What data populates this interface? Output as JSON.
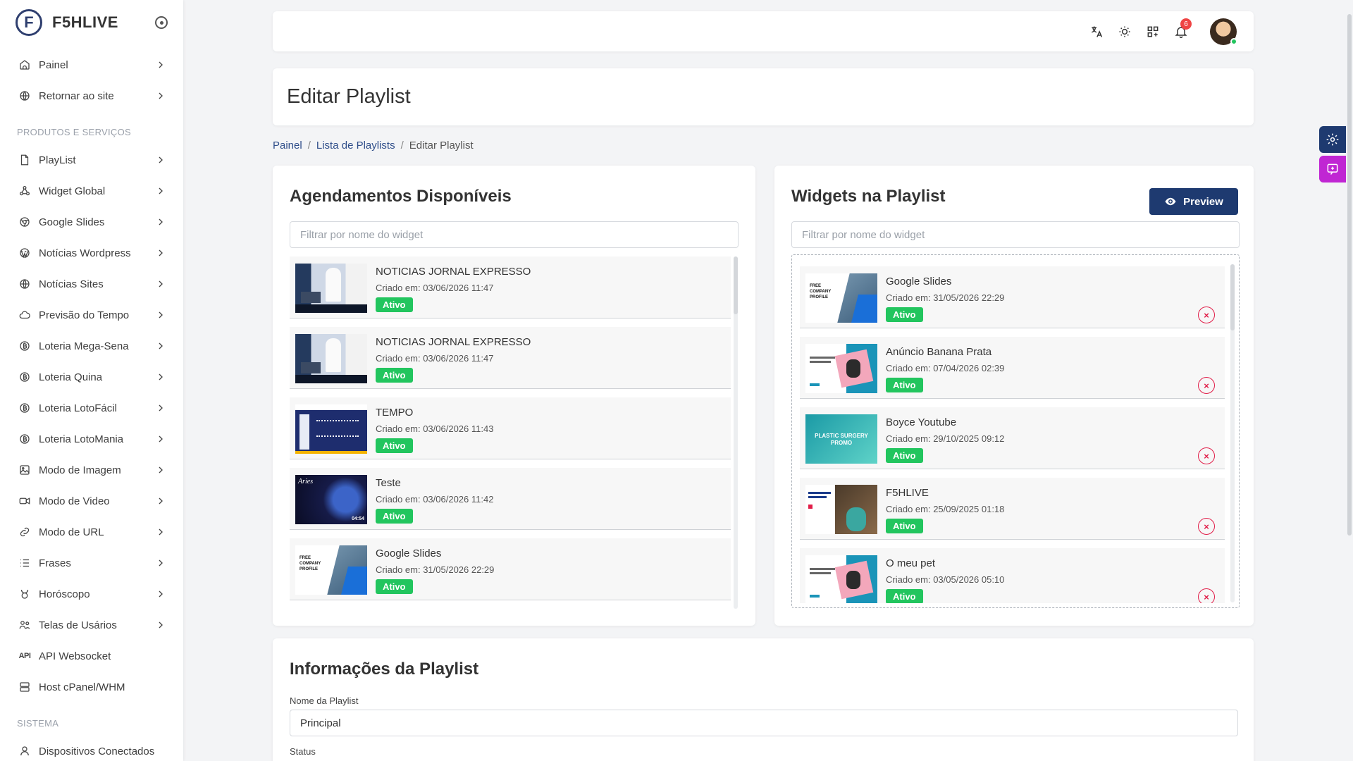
{
  "brand": {
    "name": "F5HLIVE",
    "logo_letter": "F"
  },
  "sidebar": {
    "top_items": [
      {
        "label": "Painel",
        "icon": "home-icon"
      },
      {
        "label": "Retornar ao site",
        "icon": "globe-icon"
      }
    ],
    "section_products": "PRODUTOS E SERVIÇOS",
    "product_items": [
      {
        "label": "PlayList",
        "icon": "file-icon"
      },
      {
        "label": "Widget Global",
        "icon": "share-icon"
      },
      {
        "label": "Google Slides",
        "icon": "chrome-icon"
      },
      {
        "label": "Notícias Wordpress",
        "icon": "wordpress-icon"
      },
      {
        "label": "Notícias Sites",
        "icon": "globe-icon"
      },
      {
        "label": "Previsão do Tempo",
        "icon": "cloud-icon"
      },
      {
        "label": "Loteria Mega-Sena",
        "icon": "coin-icon"
      },
      {
        "label": "Loteria Quina",
        "icon": "coin-icon"
      },
      {
        "label": "Loteria LotoFácil",
        "icon": "coin-icon"
      },
      {
        "label": "Loteria LotoMania",
        "icon": "coin-icon"
      },
      {
        "label": "Modo de Imagem",
        "icon": "image-icon"
      },
      {
        "label": "Modo de Video",
        "icon": "video-icon"
      },
      {
        "label": "Modo de URL",
        "icon": "link-icon"
      },
      {
        "label": "Frases",
        "icon": "list-icon"
      },
      {
        "label": "Horóscopo",
        "icon": "taurus-icon"
      },
      {
        "label": "Telas de Usários",
        "icon": "users-icon"
      }
    ],
    "api_item": {
      "label": "API Websocket",
      "tag": "API"
    },
    "host_item": {
      "label": "Host cPanel/WHM",
      "icon": "server-icon"
    },
    "section_system": "SISTEMA",
    "system_items": [
      {
        "label": "Dispositivos Conectados",
        "icon": "user-icon"
      }
    ]
  },
  "topbar": {
    "notification_count": "6"
  },
  "page": {
    "title": "Editar Playlist"
  },
  "breadcrumb": {
    "home": "Painel",
    "list": "Lista de Playlists",
    "current": "Editar Playlist",
    "sep": "/"
  },
  "available": {
    "title": "Agendamentos Disponíveis",
    "filter_placeholder": "Filtrar por nome do widget",
    "items": [
      {
        "title": "NOTICIAS JORNAL EXPRESSO",
        "date": "Criado em: 03/06/2026 11:47",
        "status": "Ativo",
        "thumb": "news"
      },
      {
        "title": "NOTICIAS JORNAL EXPRESSO",
        "date": "Criado em: 03/06/2026 11:47",
        "status": "Ativo",
        "thumb": "news"
      },
      {
        "title": "TEMPO",
        "date": "Criado em: 03/06/2026 11:43",
        "status": "Ativo",
        "thumb": "weather"
      },
      {
        "title": "Teste",
        "date": "Criado em: 03/06/2026 11:42",
        "status": "Ativo",
        "thumb": "aries"
      },
      {
        "title": "Google Slides",
        "date": "Criado em: 31/05/2026 22:29",
        "status": "Ativo",
        "thumb": "slides"
      }
    ]
  },
  "playlist": {
    "title": "Widgets na Playlist",
    "preview_label": "Preview",
    "filter_placeholder": "Filtrar por nome do widget",
    "items": [
      {
        "title": "Google Slides",
        "date": "Criado em: 31/05/2026 22:29",
        "status": "Ativo",
        "thumb": "slides",
        "remove": "×"
      },
      {
        "title": "Anúncio Banana Prata",
        "date": "Criado em: 07/04/2026 02:39",
        "status": "Ativo",
        "thumb": "pet",
        "remove": "×"
      },
      {
        "title": "Boyce Youtube",
        "date": "Criado em: 29/10/2025 09:12",
        "status": "Ativo",
        "thumb": "promo",
        "remove": "×"
      },
      {
        "title": "F5HLIVE",
        "date": "Criado em: 25/09/2025 01:18",
        "status": "Ativo",
        "thumb": "vaccine",
        "remove": "×"
      },
      {
        "title": "O meu pet",
        "date": "Criado em: 03/05/2026 05:10",
        "status": "Ativo",
        "thumb": "pet",
        "remove": "×"
      }
    ]
  },
  "info": {
    "title": "Informações da Playlist",
    "name_label": "Nome da Playlist",
    "name_value": "Principal",
    "status_label": "Status"
  },
  "thumb_texts": {
    "slides_line1": "FREE",
    "slides_line2": "COMPANY",
    "slides_line3": "PROFILE",
    "aries": "Aries",
    "aries_time": "04:54",
    "promo_line1": "PLASTIC SURGERY",
    "promo_line2": "PROMO"
  },
  "colors": {
    "accent": "#1e3a70",
    "success": "#22c55e",
    "danger": "#e11d48",
    "float_settings": "#1e3a70",
    "float_chat": "#c026d3"
  }
}
